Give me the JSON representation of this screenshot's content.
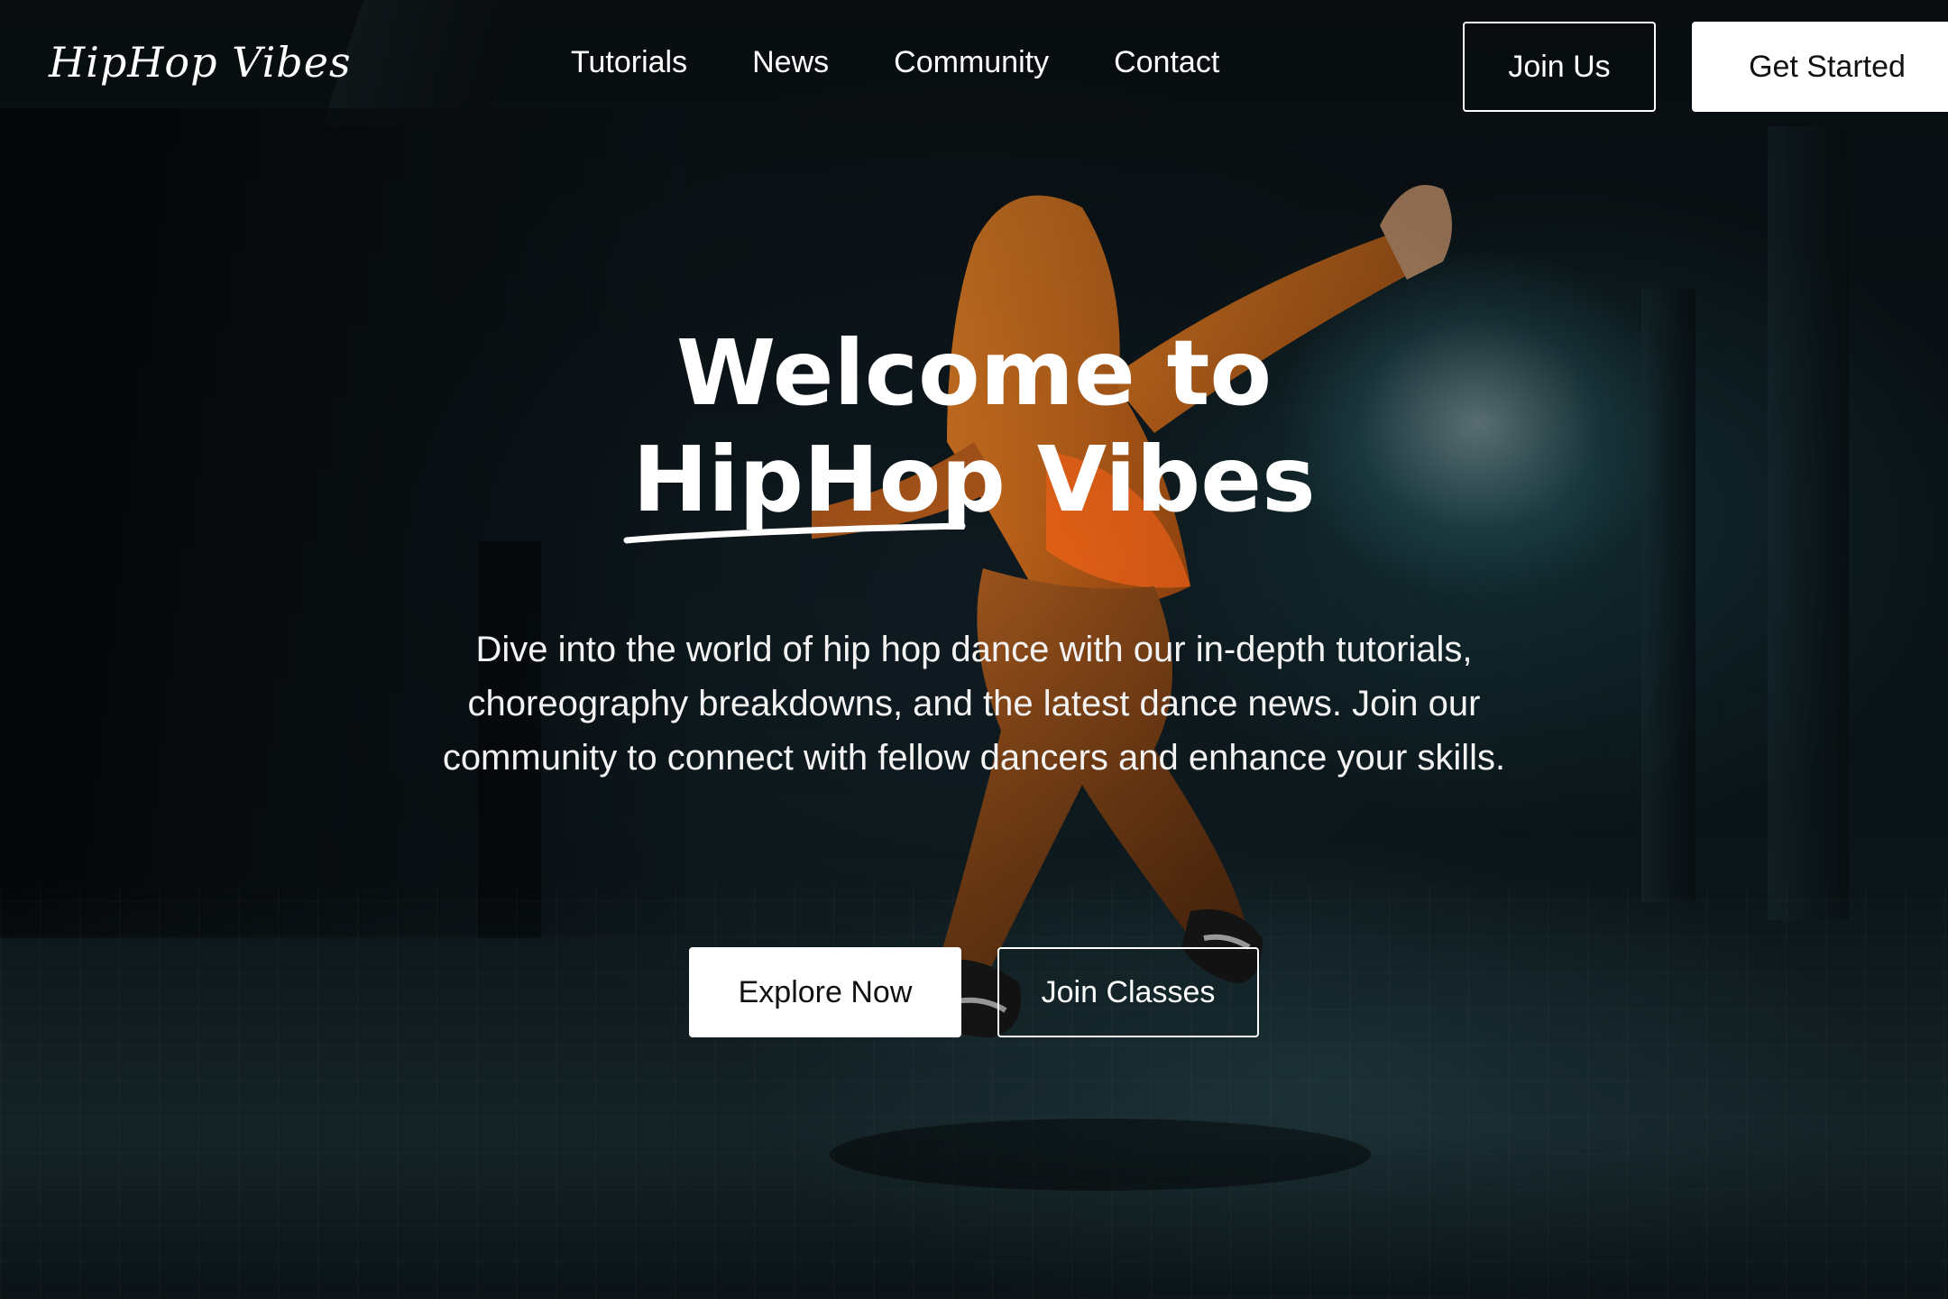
{
  "colors": {
    "text": "#ffffff",
    "button_solid_bg": "#ffffff",
    "button_solid_text": "#111111",
    "hoodie": "#e0701c",
    "background": "#0d1418"
  },
  "navbar": {
    "logo": "HipHop Vibes",
    "links": [
      {
        "label": "Tutorials"
      },
      {
        "label": "News"
      },
      {
        "label": "Community"
      },
      {
        "label": "Contact"
      }
    ],
    "join_us_label": "Join Us",
    "get_started_label": "Get Started"
  },
  "hero": {
    "headline_line1": "Welcome to",
    "headline_highlight": "HipHop",
    "headline_rest": "Vibes",
    "description": "Dive into the world of hip hop dance with our in-depth tutorials, choreography breakdowns, and the latest dance news. Join our community to connect with fellow dancers and enhance your skills.",
    "explore_label": "Explore Now",
    "join_classes_label": "Join Classes",
    "background_image": "dancer-in-orange-hoodie-dark-hallway"
  }
}
